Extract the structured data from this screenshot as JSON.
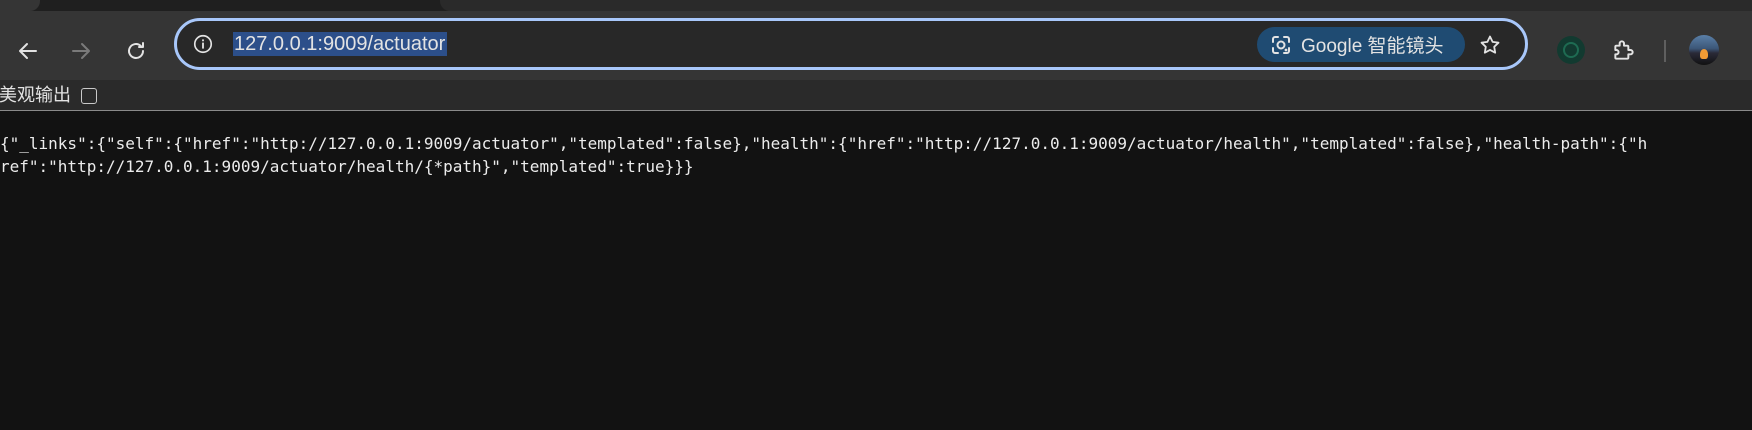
{
  "browser": {
    "address_bar": {
      "url": "127.0.0.1:9009/actuator"
    },
    "lens_chip": {
      "label": "Google 智能镜头"
    },
    "icons": {
      "back": "arrow-left-icon",
      "forward": "arrow-right-icon",
      "reload": "reload-icon",
      "site_info": "info-circle-icon",
      "lens": "camera-lens-icon",
      "bookmark": "star-icon",
      "extension": "green-extension-icon",
      "extensions_menu": "puzzle-icon",
      "profile": "avatar"
    },
    "colors": {
      "toolbar_bg": "#353535",
      "omnibox_border": "#a8c7fa",
      "url_selection": "#2c4f8a",
      "lens_chip_bg": "#1f4b72",
      "page_bg": "#121212"
    }
  },
  "json_viewer": {
    "pretty_print_label": "美观输出",
    "pretty_print_checked": false,
    "raw_json": "{\"_links\":{\"self\":{\"href\":\"http://127.0.0.1:9009/actuator\",\"templated\":false},\"health\":{\"href\":\"http://127.0.0.1:9009/actuator/health\",\"templated\":false},\"health-path\":{\"href\":\"http://127.0.0.1:9009/actuator/health/{*path}\",\"templated\":true}}}"
  }
}
